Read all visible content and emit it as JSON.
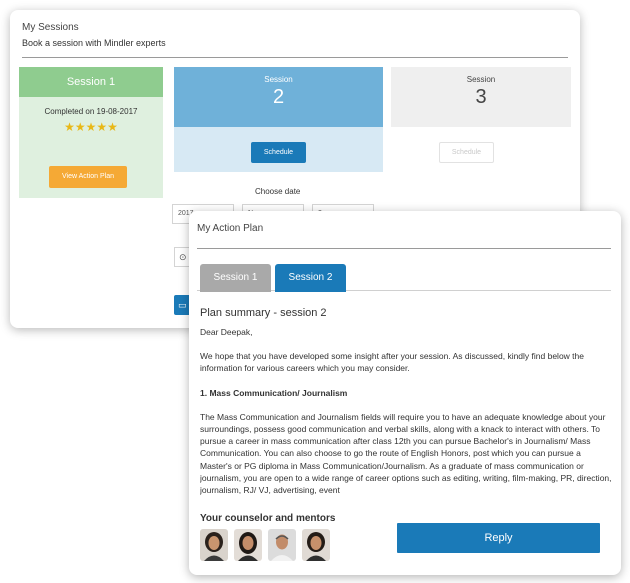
{
  "sessions_panel": {
    "title": "My Sessions",
    "subtitle": "Book a session with Mindler experts",
    "session1": {
      "label": "Session 1",
      "completed": "Completed on 19-08-2017",
      "rating_stars": 5,
      "stars_text": "★★★★★",
      "button": "View Action Plan"
    },
    "session2": {
      "label": "Session",
      "number": "2",
      "button": "Schedule"
    },
    "session3": {
      "label": "Session",
      "number": "3",
      "button": "Schedule"
    },
    "choose_date": "Choose date",
    "date_selects": [
      "2017",
      "N",
      "2"
    ],
    "colors": {
      "completed": "#8fcc8f",
      "active": "#6fb1d9",
      "accent": "#1a7ab8",
      "orange": "#f5a935",
      "star": "#e8b818"
    }
  },
  "action_plan": {
    "title": "My Action Plan",
    "tabs": [
      {
        "label": "Session 1",
        "active": false
      },
      {
        "label": "Session 2",
        "active": true
      }
    ],
    "plan_title": "Plan summary - session 2",
    "greeting": "Dear Deepak,",
    "intro": "We hope that you have developed some insight after your session. As discussed, kindly find below the information for various careers which you may consider.",
    "section_heading": "1. Mass Communication/ Journalism",
    "section_body": "The Mass Communication and Journalism fields will require you to have an adequate knowledge about your surroundings, possess good communication and verbal skills, along with a knack to interact with others. To pursue a career in mass communication after class 12th you can pursue Bachelor's in Journalism/ Mass Communication. You can also choose to go the route of English Honors, post which you can pursue a Master's or PG diploma in Mass Communication/Journalism. As a graduate of mass communication or journalism, you are open to a wide range of career options such as editing, writing, film-making, PR, direction, journalism, RJ/ VJ, advertising, event",
    "mentors_label": "Your counselor and mentors",
    "reply_button": "Reply"
  }
}
